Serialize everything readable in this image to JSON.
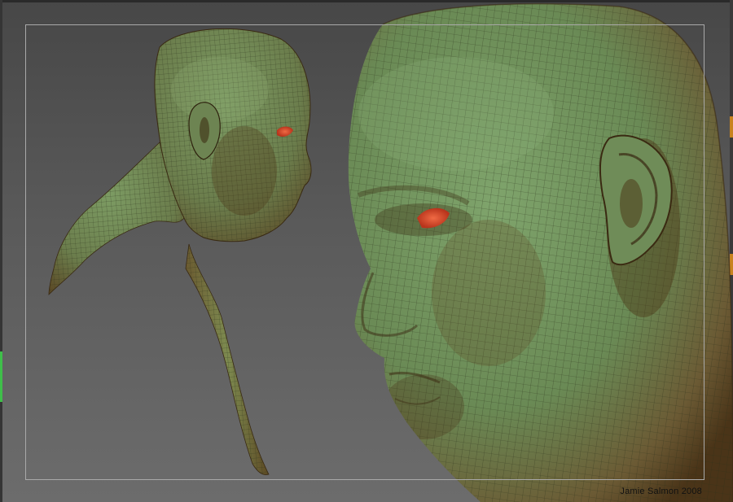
{
  "canvas": {
    "background_top": "#474747",
    "background_bottom": "#6c6c6c"
  },
  "colors": {
    "skin_green": "#6d8f5a",
    "skin_brown": "#7a5a32",
    "eye_red": "#d8452a",
    "wire": "#2b2f1a",
    "accent_orange": "#c8831f",
    "accent_green": "#3fbf4a"
  },
  "signature": {
    "text": "Jamie Salmon 2008"
  }
}
